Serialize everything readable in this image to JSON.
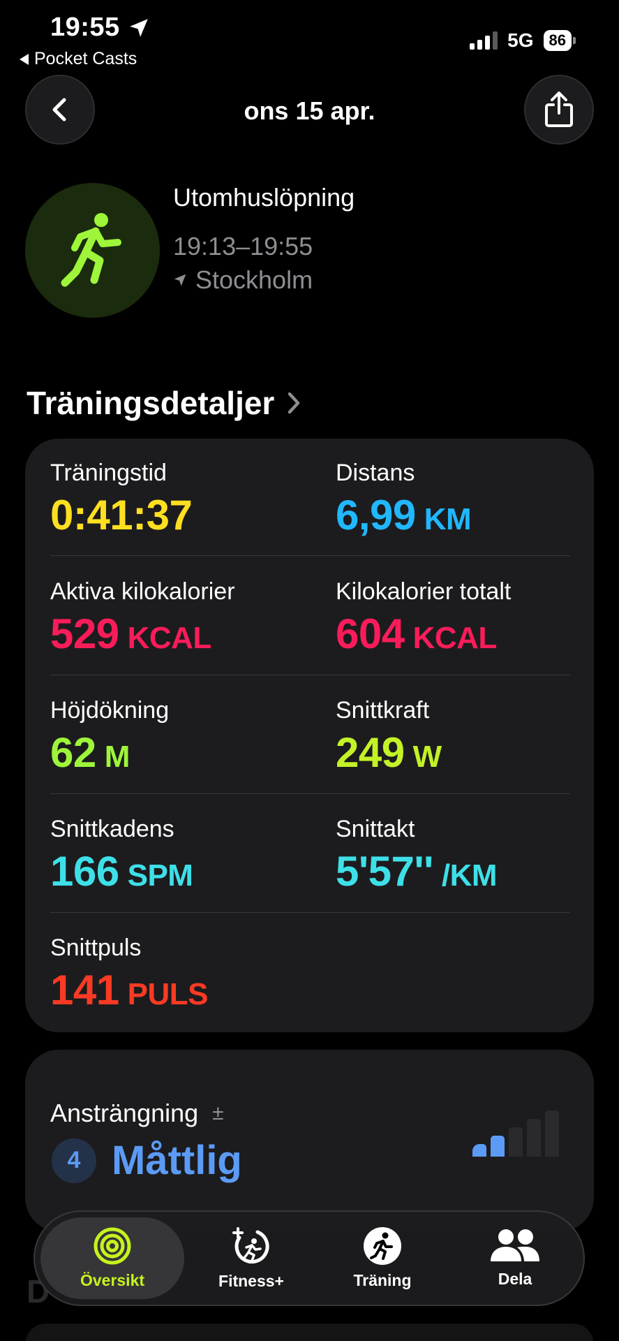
{
  "status_bar": {
    "time": "19:55",
    "back_app": "Pocket Casts",
    "network": "5G",
    "battery": "86"
  },
  "nav": {
    "title": "ons 15 apr."
  },
  "workout": {
    "name": "Utomhuslöpning",
    "time_range": "19:13–19:55",
    "location": "Stockholm"
  },
  "section": {
    "title": "Träningsdetaljer"
  },
  "metrics": [
    {
      "label": "Träningstid",
      "value": "0:41:37",
      "unit": "",
      "color": "#ffe020"
    },
    {
      "label": "Distans",
      "value": "6,99",
      "unit": "KM",
      "color": "#21b7ff"
    },
    {
      "label": "Aktiva kilokalorier",
      "value": "529",
      "unit": "KCAL",
      "color": "#fa1c5a"
    },
    {
      "label": "Kilokalorier totalt",
      "value": "604",
      "unit": "KCAL",
      "color": "#fa1c5a"
    },
    {
      "label": "Höjdökning",
      "value": "62",
      "unit": "M",
      "color": "#9ef53a"
    },
    {
      "label": "Snittkraft",
      "value": "249",
      "unit": "W",
      "color": "#c3f227"
    },
    {
      "label": "Snittkadens",
      "value": "166",
      "unit": "SPM",
      "color": "#3ee0e8"
    },
    {
      "label": "Snittakt",
      "value": "5'57''",
      "unit": "/KM",
      "color": "#3ee0e8"
    },
    {
      "label": "Snittpuls",
      "value": "141",
      "unit": "PULS",
      "color": "#fa3a24"
    }
  ],
  "effort": {
    "label": "Ansträngning",
    "adjust_symbol": "±",
    "level": "4",
    "level_text": "Måttlig",
    "level_fraction": 0.4,
    "color": "#5b9bf5"
  },
  "tabbar": {
    "tabs": [
      {
        "label": "Översikt",
        "icon": "activity-rings-icon",
        "active": true
      },
      {
        "label": "Fitness+",
        "icon": "fitness-plus-icon",
        "active": false
      },
      {
        "label": "Träning",
        "icon": "workout-runner-icon",
        "active": false
      },
      {
        "label": "Dela",
        "icon": "sharing-people-icon",
        "active": false
      }
    ]
  },
  "colors": {
    "accent_green": "#c6f31e",
    "background": "#000000",
    "card": "#1c1c1e"
  }
}
